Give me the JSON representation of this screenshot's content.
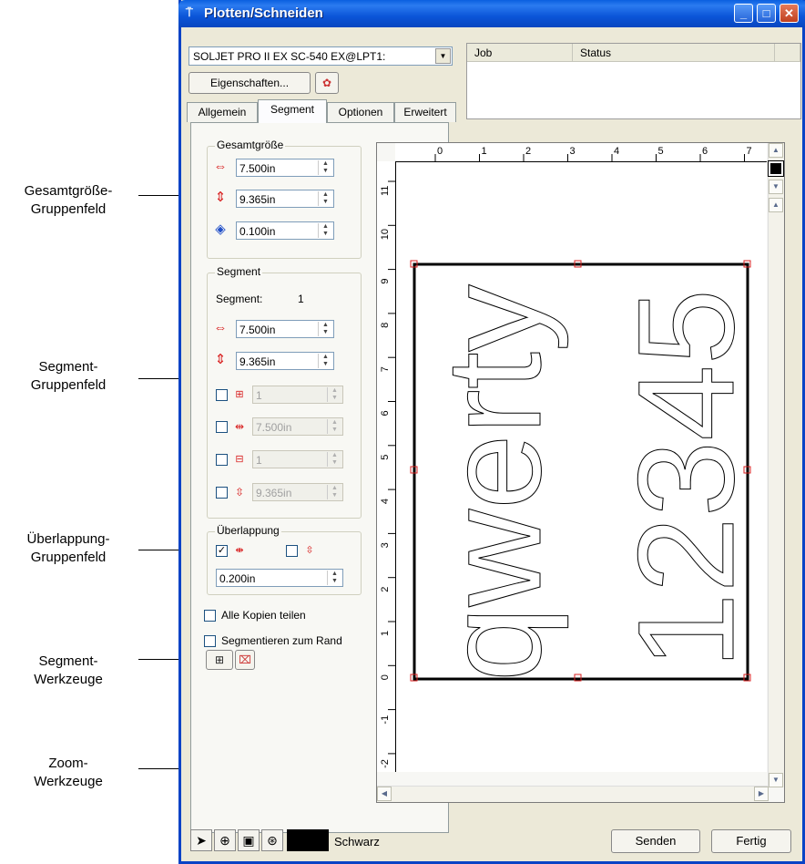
{
  "window": {
    "title": "Plotten/Schneiden"
  },
  "device": {
    "selected": "SOLJET PRO II EX SC-540 EX@LPT1:"
  },
  "buttons": {
    "properties": "Eigenschaften...",
    "send": "Senden",
    "done": "Fertig"
  },
  "job_table": {
    "columns": [
      "Job",
      "Status"
    ]
  },
  "tabs": [
    {
      "label": "Allgemein",
      "active": false
    },
    {
      "label": "Segment",
      "active": true
    },
    {
      "label": "Optionen",
      "active": false
    },
    {
      "label": "Erweitert",
      "active": false
    }
  ],
  "total_size": {
    "label": "Gesamtgröße",
    "width": "7.500in",
    "height": "9.365in",
    "margin": "0.100in"
  },
  "segment": {
    "label": "Segment",
    "segment_caption": "Segment:",
    "segment_number": "1",
    "width": "7.500in",
    "height": "9.365in",
    "columns": "1",
    "col_width": "7.500in",
    "rows": "1",
    "row_height": "9.365in"
  },
  "overlap": {
    "label": "Überlappung",
    "horizontal_checked": true,
    "vertical_checked": false,
    "value": "0.200in"
  },
  "options": {
    "share_copies": "Alle Kopien teilen",
    "segment_to_edge": "Segmentieren zum Rand"
  },
  "ruler": {
    "top_ticks": [
      "0",
      "1",
      "2",
      "3",
      "4",
      "5",
      "6",
      "7"
    ],
    "left_ticks": [
      "11",
      "10",
      "9",
      "8",
      "7",
      "6",
      "5",
      "4",
      "3",
      "2",
      "1",
      "0",
      "-1",
      "-2"
    ]
  },
  "artwork": {
    "text_left": "qwerty",
    "text_right": "12345"
  },
  "color": {
    "name": "Schwarz",
    "swatch": "#000000"
  },
  "callouts": {
    "total_size": [
      "Gesamtgröße-",
      "Gruppenfeld"
    ],
    "segment": [
      "Segment-",
      "Gruppenfeld"
    ],
    "overlap": [
      "Überlappung-",
      "Gruppenfeld"
    ],
    "segment_tools": [
      "Segment-",
      "Werkzeuge"
    ],
    "zoom_tools": [
      "Zoom-",
      "Werkzeuge"
    ]
  },
  "colors": {
    "title_bar": "#0a5fe0",
    "selection_handle": "#d82020"
  }
}
